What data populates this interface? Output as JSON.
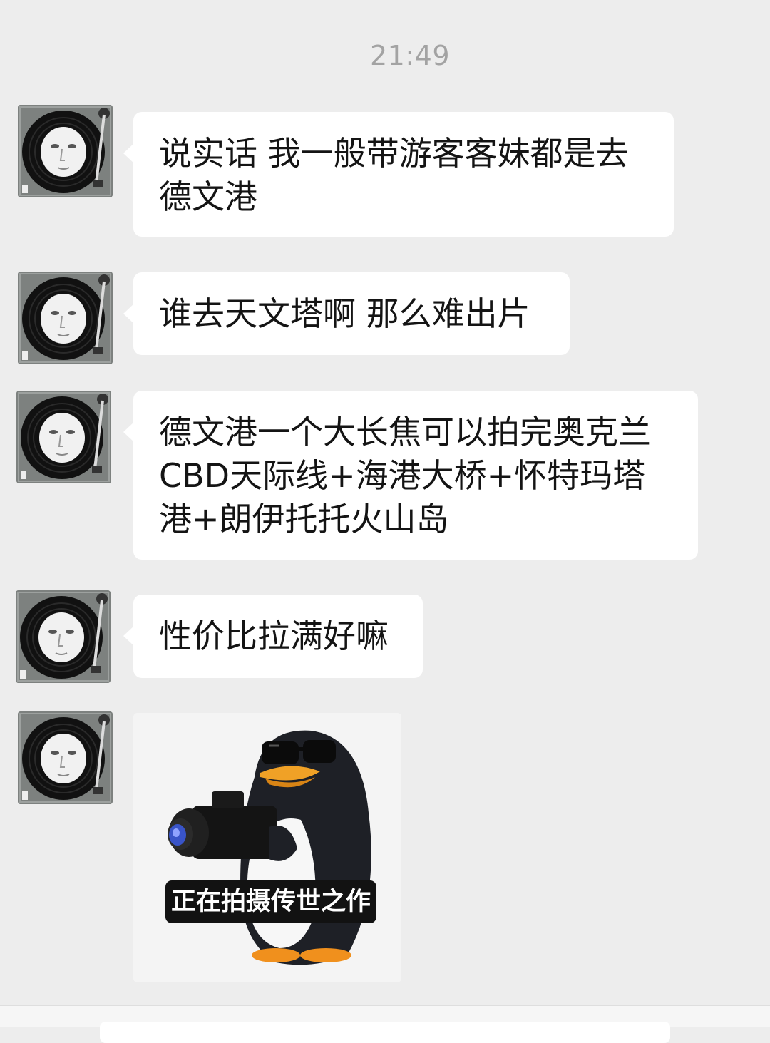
{
  "chat": {
    "timestamp": "21:49",
    "messages": [
      {
        "type": "text",
        "text": "说实话 我一般带游客客妹都是去\n德文港"
      },
      {
        "type": "text",
        "text": "谁去天文塔啊 那么难出片"
      },
      {
        "type": "text",
        "text": "德文港一个大长焦可以拍完奥克兰\nCBD天际线+海港大桥+怀特玛塔\n港+朗伊托托火山岛"
      },
      {
        "type": "text",
        "text": "性价比拉满好嘛"
      },
      {
        "type": "sticker",
        "caption": "正在拍摄传世之作",
        "icon": "penguin-with-camera-sticker"
      }
    ]
  },
  "avatar": {
    "icon": "turntable-face-avatar"
  },
  "colors": {
    "background": "#ededed",
    "bubble": "#ffffff",
    "text": "#141414",
    "timestamp": "#a3a3a3"
  }
}
